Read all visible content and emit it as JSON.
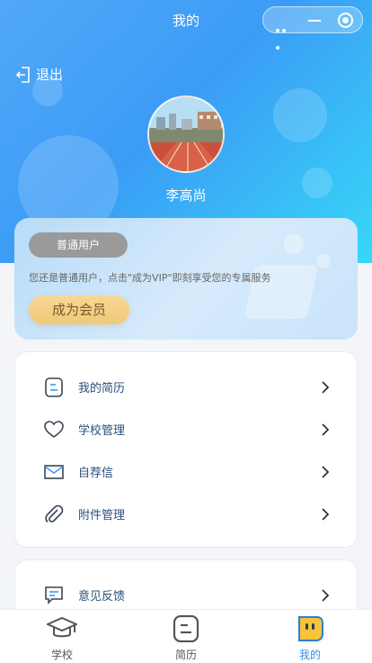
{
  "nav": {
    "title": "我的"
  },
  "header": {
    "logout_label": "退出",
    "username": "李高尚"
  },
  "member": {
    "badge": "普通用户",
    "description": "您还是普通用户，点击\"成为VIP\"即刻享受您的专属服务",
    "vip_button": "成为会员"
  },
  "menu": {
    "items": [
      {
        "label": "我的简历",
        "icon": "resume-icon"
      },
      {
        "label": "学校管理",
        "icon": "heart-icon"
      },
      {
        "label": "自荐信",
        "icon": "mail-icon"
      },
      {
        "label": "附件管理",
        "icon": "paperclip-icon"
      }
    ]
  },
  "menu2": {
    "items": [
      {
        "label": "意见反馈",
        "icon": "feedback-icon"
      }
    ]
  },
  "tabbar": {
    "tabs": [
      {
        "label": "学校",
        "icon": "graduation-cap-icon"
      },
      {
        "label": "简历",
        "icon": "resume-tab-icon"
      },
      {
        "label": "我的",
        "icon": "profile-face-icon"
      }
    ]
  },
  "colors": {
    "accent": "#3b9cf6",
    "link": "#2a4f7a",
    "vip": "#f0c978"
  }
}
